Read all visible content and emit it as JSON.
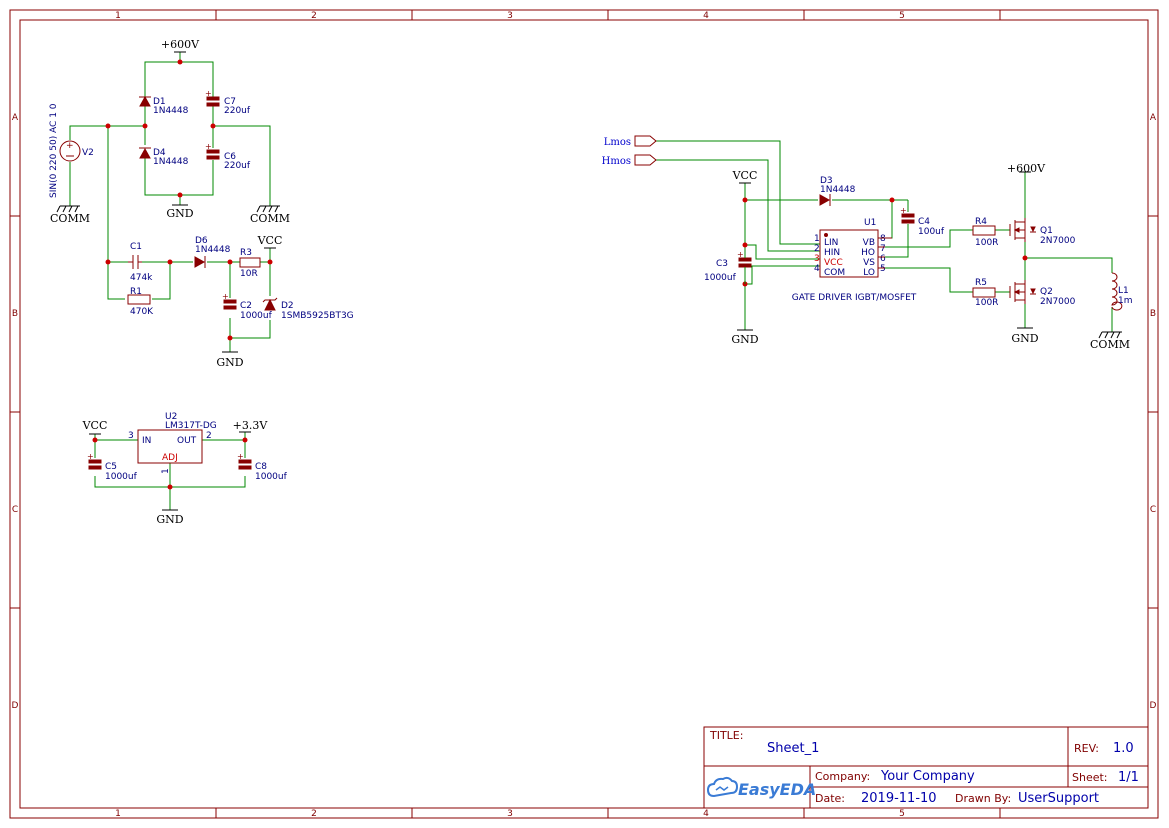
{
  "frame": {
    "col_labels": [
      "1",
      "2",
      "3",
      "4",
      "5"
    ],
    "row_labels": [
      "A",
      "B",
      "C",
      "D"
    ]
  },
  "nets": {
    "v600": "+600V",
    "gnd": "GND",
    "comm": "COMM",
    "vcc": "VCC",
    "v33": "+3.3V"
  },
  "ports": {
    "lmos": "Lmos",
    "hmos": "Hmos"
  },
  "components": {
    "v2": {
      "ref": "V2",
      "value": "SIN(0 220 50) AC 1 0"
    },
    "d1": {
      "ref": "D1",
      "value": "1N4448"
    },
    "d4": {
      "ref": "D4",
      "value": "1N4448"
    },
    "c7": {
      "ref": "C7",
      "value": "220uf"
    },
    "c6": {
      "ref": "C6",
      "value": "220uf"
    },
    "c1": {
      "ref": "C1",
      "value": "474k"
    },
    "r1": {
      "ref": "R1",
      "value": "470K"
    },
    "d6": {
      "ref": "D6",
      "value": "1N4448"
    },
    "r3": {
      "ref": "R3",
      "value": "10R"
    },
    "c2": {
      "ref": "C2",
      "value": "1000uf"
    },
    "d2": {
      "ref": "D2",
      "value": "1SMB5925BT3G"
    },
    "u2": {
      "ref": "U2",
      "value": "LM317T-DG",
      "pin_in": "IN",
      "pin_out": "OUT",
      "pin_adj": "ADJ",
      "n3": "3",
      "n2": "2",
      "n1": "1"
    },
    "c5": {
      "ref": "C5",
      "value": "1000uf"
    },
    "c8": {
      "ref": "C8",
      "value": "1000uf"
    },
    "d3": {
      "ref": "D3",
      "value": "1N4448"
    },
    "u1": {
      "ref": "U1",
      "value": "GATE DRIVER IGBT/MOSFET",
      "pins_left": [
        "LIN",
        "HIN",
        "VCC",
        "COM"
      ],
      "nums_left": [
        "1",
        "2",
        "3",
        "4"
      ],
      "pins_right": [
        "VB",
        "HO",
        "VS",
        "LO"
      ],
      "nums_right": [
        "8",
        "7",
        "6",
        "5"
      ]
    },
    "c4": {
      "ref": "C4",
      "value": "100uf"
    },
    "c3": {
      "ref": "C3",
      "value": "1000uf"
    },
    "r4": {
      "ref": "R4",
      "value": "100R"
    },
    "r5": {
      "ref": "R5",
      "value": "100R"
    },
    "q1": {
      "ref": "Q1",
      "value": "2N7000"
    },
    "q2": {
      "ref": "Q2",
      "value": "2N7000"
    },
    "l1": {
      "ref": "L1",
      "value": "1m"
    }
  },
  "title_block": {
    "title_label": "TITLE:",
    "title": "Sheet_1",
    "rev_label": "REV:",
    "rev": "1.0",
    "company_label": "Company:",
    "company": "Your Company",
    "sheet_label": "Sheet:",
    "sheet": "1/1",
    "date_label": "Date:",
    "date": "2019-11-10",
    "drawn_label": "Drawn By:",
    "drawn": "UserSupport",
    "logo": "EasyEDA"
  }
}
